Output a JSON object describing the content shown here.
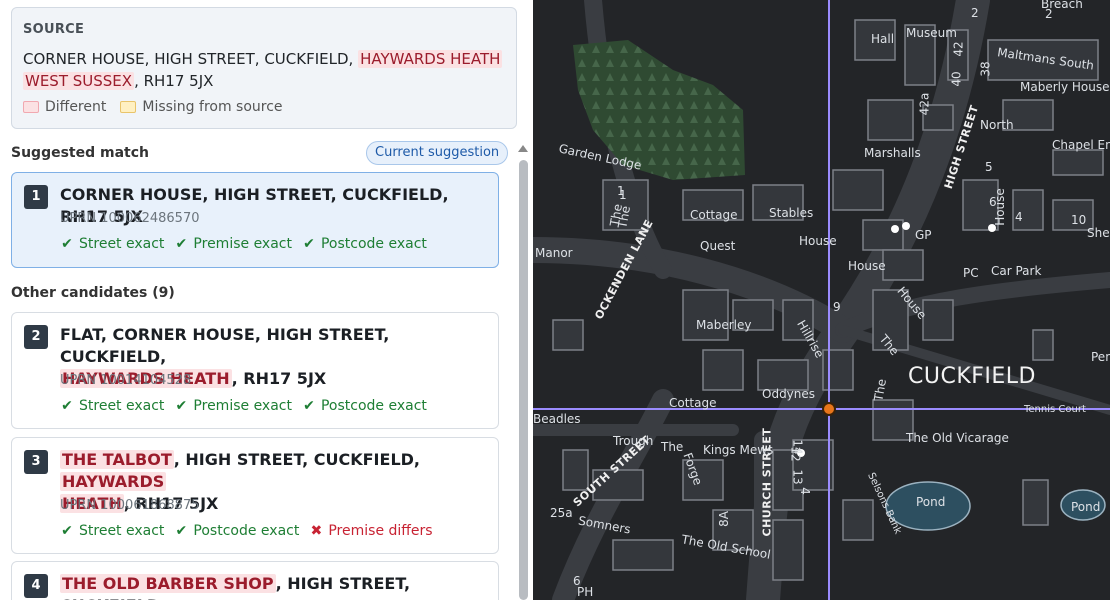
{
  "source": {
    "label": "SOURCE",
    "address_parts": [
      "CORNER HOUSE, HIGH STREET, CUCKFIELD, ",
      "HAYWARDS HEATH",
      "WEST SUSSEX",
      ", RH17 5JX"
    ],
    "legend_different": "Different",
    "legend_missing": "Missing from source"
  },
  "suggested": {
    "title": "Suggested match",
    "pill": "Current suggestion",
    "rank": "1",
    "address": "CORNER HOUSE, HIGH STREET, CUCKFIELD, RH17 5JX",
    "uprn": "UPRN 100062486570",
    "checks": [
      "Street exact",
      "Premise exact",
      "Postcode exact"
    ]
  },
  "others": {
    "title": "Other candidates (",
    "count": "9",
    "title_end": ")"
  },
  "candidates": [
    {
      "rank": "2",
      "line1": "FLAT, CORNER HOUSE, HIGH STREET, CUCKFIELD,",
      "diff2": "HAYWARDS HEATH",
      "rest2": ", RH17 5JX",
      "uprn": "UPRN 10014104528",
      "checks": [
        "Street exact",
        "Premise exact",
        "Postcode exact"
      ]
    },
    {
      "rank": "3",
      "diff1": "THE TALBOT",
      "mid1": ", HIGH STREET, CUCKFIELD, ",
      "diff1b": "HAYWARDS",
      "diff2": "HEATH",
      "rest2": ", RH17 5JX",
      "uprn": "UPRN 100061868875",
      "checks": [
        "Street exact",
        "Postcode exact"
      ],
      "bad": "Premise differs"
    },
    {
      "rank": "4",
      "diff1": "THE OLD BARBER SHOP",
      "rest1": ", HIGH STREET, CUCKFIELD,"
    }
  ],
  "map": {
    "town": "CUCKFIELD",
    "streets": [
      "HIGH STREET",
      "OCKENDEN LANE",
      "SOUTH STREET",
      "CHURCH STREET",
      "Selsons Bank"
    ],
    "labels": [
      "Breach",
      "Hall",
      "Museum",
      "Maltmans South",
      "Maberly House",
      "North",
      "Chapel End",
      "Marshalls",
      "Garden Lodge",
      "Cottage",
      "Stables",
      "House",
      "Quest",
      "Manor",
      "GP",
      "House",
      "PC",
      "Car Park",
      "House",
      "The",
      "Maberley",
      "Hillrise",
      "Oddynes",
      "Cottage",
      "Beadles",
      "Trough",
      "The",
      "Kings Mews",
      "The Old Vicarage",
      "Tennis Court",
      "Pond",
      "Pond",
      "Forge",
      "Somners",
      "The Old School",
      "PH",
      "25a",
      "Shel",
      "Penn",
      "The",
      "8A",
      "The",
      "12",
      "42a",
      "42",
      "40",
      "38",
      "9",
      "1",
      "2",
      "4",
      "5",
      "6",
      "10",
      "13",
      "14",
      "The",
      "House",
      "1",
      "2",
      "4",
      "6"
    ],
    "accent": "#9b8cff",
    "pin": "#e8751a"
  }
}
